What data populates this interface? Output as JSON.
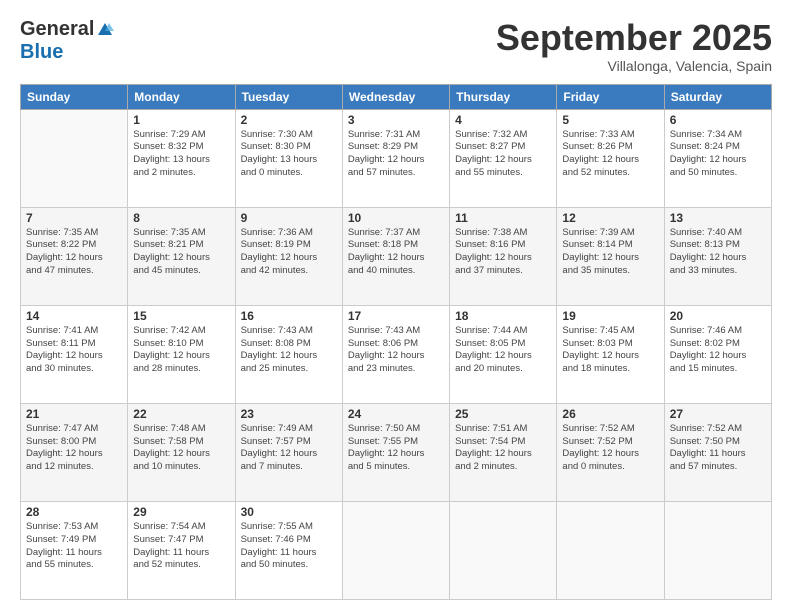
{
  "logo": {
    "general": "General",
    "blue": "Blue"
  },
  "header": {
    "month": "September 2025",
    "location": "Villalonga, Valencia, Spain"
  },
  "weekdays": [
    "Sunday",
    "Monday",
    "Tuesday",
    "Wednesday",
    "Thursday",
    "Friday",
    "Saturday"
  ],
  "weeks": [
    [
      {
        "day": "",
        "info": ""
      },
      {
        "day": "1",
        "info": "Sunrise: 7:29 AM\nSunset: 8:32 PM\nDaylight: 13 hours\nand 2 minutes."
      },
      {
        "day": "2",
        "info": "Sunrise: 7:30 AM\nSunset: 8:30 PM\nDaylight: 13 hours\nand 0 minutes."
      },
      {
        "day": "3",
        "info": "Sunrise: 7:31 AM\nSunset: 8:29 PM\nDaylight: 12 hours\nand 57 minutes."
      },
      {
        "day": "4",
        "info": "Sunrise: 7:32 AM\nSunset: 8:27 PM\nDaylight: 12 hours\nand 55 minutes."
      },
      {
        "day": "5",
        "info": "Sunrise: 7:33 AM\nSunset: 8:26 PM\nDaylight: 12 hours\nand 52 minutes."
      },
      {
        "day": "6",
        "info": "Sunrise: 7:34 AM\nSunset: 8:24 PM\nDaylight: 12 hours\nand 50 minutes."
      }
    ],
    [
      {
        "day": "7",
        "info": "Sunrise: 7:35 AM\nSunset: 8:22 PM\nDaylight: 12 hours\nand 47 minutes."
      },
      {
        "day": "8",
        "info": "Sunrise: 7:35 AM\nSunset: 8:21 PM\nDaylight: 12 hours\nand 45 minutes."
      },
      {
        "day": "9",
        "info": "Sunrise: 7:36 AM\nSunset: 8:19 PM\nDaylight: 12 hours\nand 42 minutes."
      },
      {
        "day": "10",
        "info": "Sunrise: 7:37 AM\nSunset: 8:18 PM\nDaylight: 12 hours\nand 40 minutes."
      },
      {
        "day": "11",
        "info": "Sunrise: 7:38 AM\nSunset: 8:16 PM\nDaylight: 12 hours\nand 37 minutes."
      },
      {
        "day": "12",
        "info": "Sunrise: 7:39 AM\nSunset: 8:14 PM\nDaylight: 12 hours\nand 35 minutes."
      },
      {
        "day": "13",
        "info": "Sunrise: 7:40 AM\nSunset: 8:13 PM\nDaylight: 12 hours\nand 33 minutes."
      }
    ],
    [
      {
        "day": "14",
        "info": "Sunrise: 7:41 AM\nSunset: 8:11 PM\nDaylight: 12 hours\nand 30 minutes."
      },
      {
        "day": "15",
        "info": "Sunrise: 7:42 AM\nSunset: 8:10 PM\nDaylight: 12 hours\nand 28 minutes."
      },
      {
        "day": "16",
        "info": "Sunrise: 7:43 AM\nSunset: 8:08 PM\nDaylight: 12 hours\nand 25 minutes."
      },
      {
        "day": "17",
        "info": "Sunrise: 7:43 AM\nSunset: 8:06 PM\nDaylight: 12 hours\nand 23 minutes."
      },
      {
        "day": "18",
        "info": "Sunrise: 7:44 AM\nSunset: 8:05 PM\nDaylight: 12 hours\nand 20 minutes."
      },
      {
        "day": "19",
        "info": "Sunrise: 7:45 AM\nSunset: 8:03 PM\nDaylight: 12 hours\nand 18 minutes."
      },
      {
        "day": "20",
        "info": "Sunrise: 7:46 AM\nSunset: 8:02 PM\nDaylight: 12 hours\nand 15 minutes."
      }
    ],
    [
      {
        "day": "21",
        "info": "Sunrise: 7:47 AM\nSunset: 8:00 PM\nDaylight: 12 hours\nand 12 minutes."
      },
      {
        "day": "22",
        "info": "Sunrise: 7:48 AM\nSunset: 7:58 PM\nDaylight: 12 hours\nand 10 minutes."
      },
      {
        "day": "23",
        "info": "Sunrise: 7:49 AM\nSunset: 7:57 PM\nDaylight: 12 hours\nand 7 minutes."
      },
      {
        "day": "24",
        "info": "Sunrise: 7:50 AM\nSunset: 7:55 PM\nDaylight: 12 hours\nand 5 minutes."
      },
      {
        "day": "25",
        "info": "Sunrise: 7:51 AM\nSunset: 7:54 PM\nDaylight: 12 hours\nand 2 minutes."
      },
      {
        "day": "26",
        "info": "Sunrise: 7:52 AM\nSunset: 7:52 PM\nDaylight: 12 hours\nand 0 minutes."
      },
      {
        "day": "27",
        "info": "Sunrise: 7:52 AM\nSunset: 7:50 PM\nDaylight: 11 hours\nand 57 minutes."
      }
    ],
    [
      {
        "day": "28",
        "info": "Sunrise: 7:53 AM\nSunset: 7:49 PM\nDaylight: 11 hours\nand 55 minutes."
      },
      {
        "day": "29",
        "info": "Sunrise: 7:54 AM\nSunset: 7:47 PM\nDaylight: 11 hours\nand 52 minutes."
      },
      {
        "day": "30",
        "info": "Sunrise: 7:55 AM\nSunset: 7:46 PM\nDaylight: 11 hours\nand 50 minutes."
      },
      {
        "day": "",
        "info": ""
      },
      {
        "day": "",
        "info": ""
      },
      {
        "day": "",
        "info": ""
      },
      {
        "day": "",
        "info": ""
      }
    ]
  ]
}
